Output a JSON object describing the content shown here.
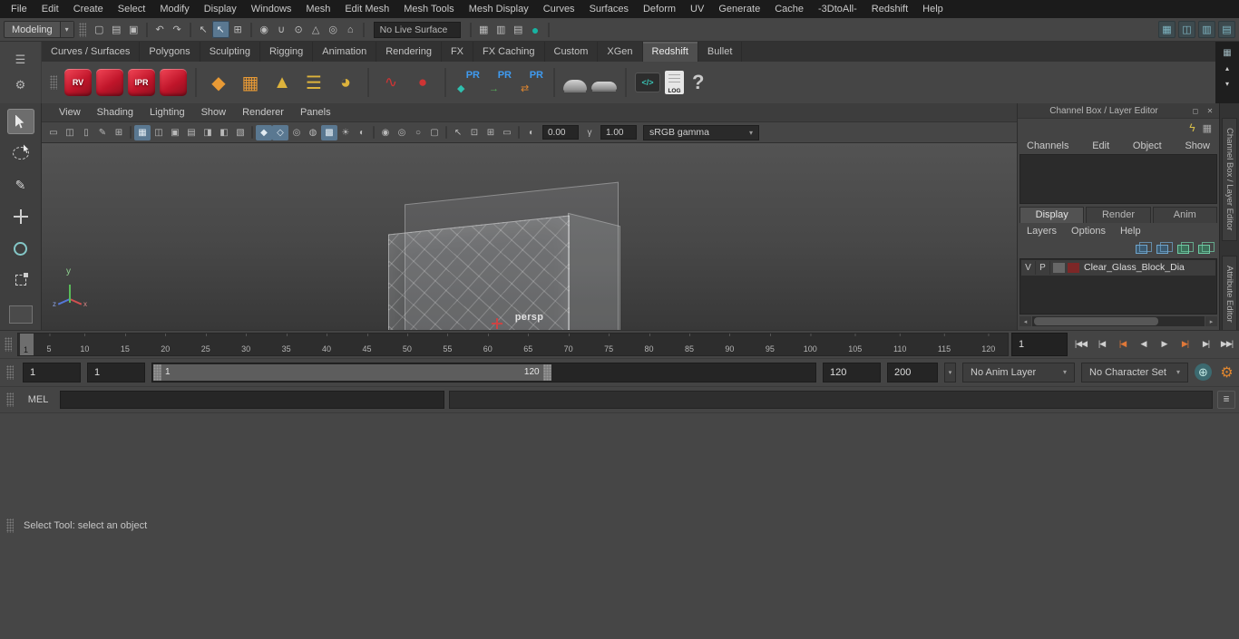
{
  "glyphs": {
    "hamburger": "☰",
    "gear": "⚙",
    "close": "✕",
    "float": "◻",
    "down": "▾",
    "up": "▴",
    "left": "◂",
    "right": "▸",
    "lightning": "ϟ",
    "grid": "▦",
    "pencil": "✎",
    "exposure": "◐",
    "gamma": "γ",
    "history": "▤",
    "script": "≣",
    "plusgear": "⊕"
  },
  "menubar": {
    "items": [
      "File",
      "Edit",
      "Create",
      "Select",
      "Modify",
      "Display",
      "Windows",
      "Mesh",
      "Edit Mesh",
      "Mesh Tools",
      "Mesh Display",
      "Curves",
      "Surfaces",
      "Deform",
      "UV",
      "Generate",
      "Cache",
      "-3DtoAll-",
      "Redshift",
      "Help"
    ]
  },
  "statusline": {
    "menuset": "Modeling",
    "live_surface": "No Live Surface",
    "left_icons": [
      {
        "g": "▢"
      },
      {
        "g": "▤"
      },
      {
        "g": "▣"
      },
      {
        "cls": "sep"
      },
      {
        "g": "↶"
      },
      {
        "g": "↷"
      },
      {
        "cls": "sep"
      },
      {
        "g": "↖"
      },
      {
        "g": "↖",
        "cls": "active"
      },
      {
        "g": "⊞"
      },
      {
        "cls": "sep"
      },
      {
        "g": "◉"
      },
      {
        "g": "∪"
      },
      {
        "g": "⊙"
      },
      {
        "g": "△"
      },
      {
        "g": "◎"
      },
      {
        "g": "⌂"
      },
      {
        "cls": "sep"
      }
    ],
    "render_icons": [
      {
        "cls": "sep"
      },
      {
        "g": "▦"
      },
      {
        "g": "▥"
      },
      {
        "g": "▤"
      },
      {
        "g": "●",
        "cls": "teal"
      },
      {
        "cls": "sep"
      }
    ],
    "workspace_icons": [
      {
        "g": "▦",
        "cls": "ws"
      },
      {
        "g": "◫",
        "cls": "ws"
      },
      {
        "g": "▥",
        "cls": "ws"
      },
      {
        "g": "▤",
        "cls": "ws"
      }
    ]
  },
  "shelf": {
    "tabs": [
      {
        "label": "Curves / Surfaces"
      },
      {
        "label": "Polygons"
      },
      {
        "label": "Sculpting"
      },
      {
        "label": "Rigging"
      },
      {
        "label": "Animation"
      },
      {
        "label": "Rendering"
      },
      {
        "label": "FX"
      },
      {
        "label": "FX Caching"
      },
      {
        "label": "Custom"
      },
      {
        "label": "XGen"
      },
      {
        "label": "Redshift",
        "active": true
      },
      {
        "label": "Bullet"
      }
    ],
    "rs_icons": [
      "RV",
      "",
      "IPR",
      ""
    ],
    "orange_icons": [
      "◆",
      "▦",
      "▲",
      "☰",
      "◕"
    ],
    "red_icons": [
      "∿",
      "●"
    ],
    "pr_label": "PR",
    "pr_subs": [
      "◆",
      "→",
      "⇄"
    ],
    "code_label": "</>",
    "log_label": "LOG",
    "help_label": "?"
  },
  "viewport": {
    "menus": [
      {
        "label": "View"
      },
      {
        "label": "Shading"
      },
      {
        "label": "Lighting"
      },
      {
        "label": "Show"
      },
      {
        "label": "Renderer"
      },
      {
        "label": "Panels"
      }
    ],
    "toolbar_icons": [
      {
        "g": "▭"
      },
      {
        "g": "◫"
      },
      {
        "g": "▯"
      },
      {
        "g": "✎"
      },
      {
        "g": "⊞"
      },
      {
        "cls": "sep"
      },
      {
        "g": "▦",
        "cls": "active"
      },
      {
        "g": "◫"
      },
      {
        "g": "▣"
      },
      {
        "g": "▤"
      },
      {
        "g": "◨"
      },
      {
        "g": "◧"
      },
      {
        "g": "▧"
      },
      {
        "cls": "sep"
      },
      {
        "g": "◆",
        "cls": "active"
      },
      {
        "g": "◇",
        "cls": "active"
      },
      {
        "g": "◎"
      },
      {
        "g": "◍"
      },
      {
        "g": "▩",
        "cls": "active"
      },
      {
        "g": "☀"
      },
      {
        "g": "◐"
      },
      {
        "cls": "sep"
      },
      {
        "g": "◉"
      },
      {
        "g": "◎"
      },
      {
        "g": "○"
      },
      {
        "g": "▢"
      },
      {
        "cls": "sep"
      },
      {
        "g": "↖"
      },
      {
        "g": "⊡"
      },
      {
        "g": "⊞"
      },
      {
        "g": "▭"
      },
      {
        "cls": "sep"
      }
    ],
    "exposure": "0.00",
    "gamma": "1.00",
    "colorspace": "sRGB gamma",
    "camera": "persp",
    "axis": {
      "y": "y",
      "x": "x",
      "z": "z"
    }
  },
  "channelbox": {
    "title": "Channel Box / Layer Editor",
    "menus": [
      {
        "label": "Channels"
      },
      {
        "label": "Edit"
      },
      {
        "label": "Object"
      },
      {
        "label": "Show"
      }
    ],
    "layer_tabs": [
      {
        "label": "Display",
        "active": true
      },
      {
        "label": "Render"
      },
      {
        "label": "Anim"
      }
    ],
    "layer_menus": [
      {
        "label": "Layers"
      },
      {
        "label": "Options"
      },
      {
        "label": "Help"
      }
    ],
    "layer_row": {
      "visible": "V",
      "playback": "P",
      "name": "Clear_Glass_Block_Dia"
    },
    "side_tabs": [
      {
        "label": "Channel Box / Layer Editor"
      },
      {
        "label": "Attribute Editor"
      }
    ]
  },
  "timeline": {
    "ticks": [
      "5",
      "10",
      "15",
      "20",
      "25",
      "30",
      "35",
      "40",
      "45",
      "50",
      "55",
      "60",
      "65",
      "70",
      "75",
      "80",
      "85",
      "90",
      "95",
      "100",
      "105",
      "110",
      "115",
      "120"
    ],
    "current_frame": "1",
    "current_frame_field": "1",
    "playback_icons": [
      {
        "g": "|◀◀"
      },
      {
        "g": "|◀"
      },
      {
        "g": "|◀",
        "cls": "key"
      },
      {
        "g": "◀"
      },
      {
        "g": "▶"
      },
      {
        "g": "▶|",
        "cls": "key"
      },
      {
        "g": "▶|"
      },
      {
        "g": "▶▶|"
      }
    ]
  },
  "range": {
    "anim_start": "1",
    "play_start": "1",
    "bar_start": "1",
    "bar_end": "120",
    "play_end": "120",
    "anim_end": "200",
    "anim_layer": "No Anim Layer",
    "character_set": "No Character Set"
  },
  "command_line": {
    "label": "MEL"
  },
  "help_line": {
    "text": "Select Tool: select an object"
  }
}
